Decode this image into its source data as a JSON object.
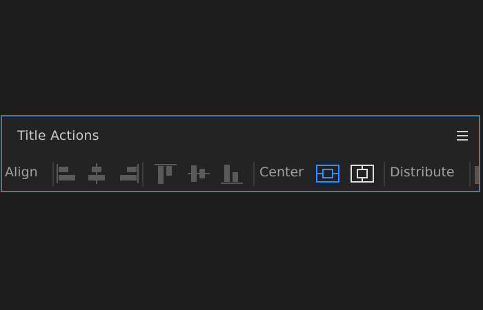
{
  "panel": {
    "title": "Title Actions",
    "menu_icon": "hamburger-menu-icon"
  },
  "toolbar": {
    "align_label": "Align",
    "center_label": "Center",
    "distribute_label": "Distribute",
    "align_tools": [
      "align-left-icon",
      "align-horizontal-center-icon",
      "align-right-icon",
      "align-top-icon",
      "align-vertical-center-icon",
      "align-bottom-icon"
    ],
    "center_tools": [
      {
        "icon": "center-horizontally-icon",
        "selected": true
      },
      {
        "icon": "center-vertically-icon",
        "selected": false
      }
    ]
  },
  "colors": {
    "background": "#1d1d1d",
    "panel": "#232323",
    "focus_border": "#2d7fd8",
    "icon_disabled": "#5a5a5a",
    "icon_active_blue": "#3d8ee6",
    "icon_active_white": "#e0e0e0"
  }
}
